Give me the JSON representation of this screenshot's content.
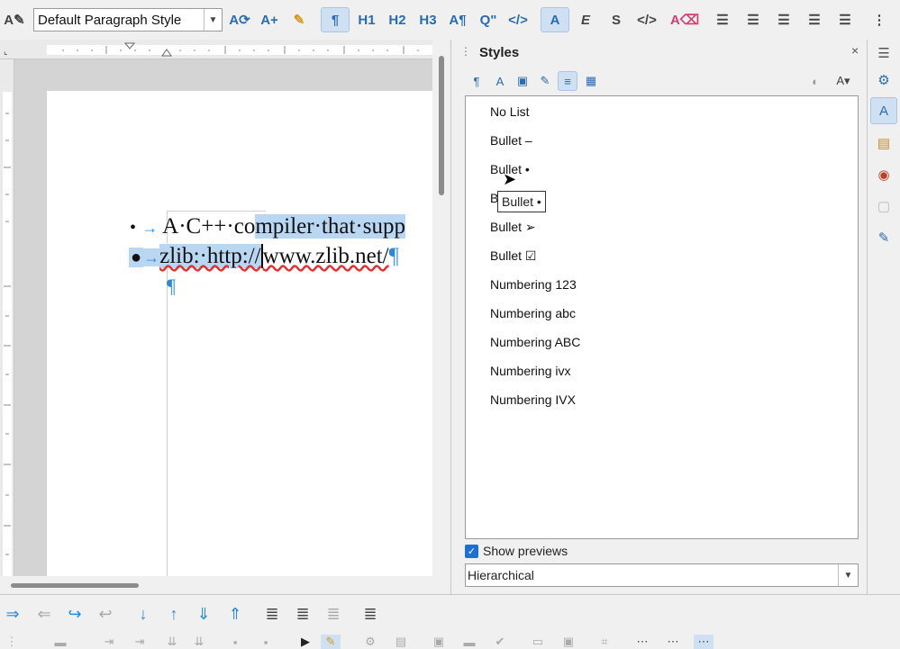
{
  "toolbar": {
    "paragraph_style": "Default Paragraph Style",
    "icons": [
      "styles-icon",
      "update-style-icon",
      "new-style-icon",
      "fill-format-icon",
      "formatting-marks-icon",
      "heading1-icon",
      "heading2-icon",
      "heading3-icon",
      "text-body-icon",
      "quotations-icon",
      "source-text-icon",
      "default-character-icon",
      "emphasis-icon",
      "strong-emphasis-icon",
      "source-code-icon",
      "no-character-style-icon",
      "unordered-list-icon",
      "ordered-list-icon",
      "list-icon-3",
      "list-icon-4",
      "list-icon-5"
    ],
    "labels": {
      "h1": "H1",
      "h2": "H2",
      "h3": "H3"
    }
  },
  "document": {
    "line1_bullet": "•",
    "line1_text_a": "A·C++·co",
    "line1_text_b": "mpiler·that·supp",
    "line2_bullet": "●",
    "line2_text_a": "zlib:·http://",
    "line2_text_b": "www.zlib.net/",
    "para_mark": "¶"
  },
  "sidebar": {
    "title": "Styles",
    "close": "×",
    "list_items": [
      "No List",
      "Bullet –",
      "Bullet •",
      "B",
      "Bullet ➢",
      "Bullet ☑",
      "Numbering 123",
      "Numbering abc",
      "Numbering ABC",
      "Numbering ivx",
      "Numbering IVX"
    ],
    "tooltip": "Bullet •",
    "show_previews_label": "Show previews",
    "show_previews_checked": true,
    "filter_value": "Hierarchical"
  },
  "deck": {
    "icons": [
      "properties-icon",
      "styles-icon",
      "gallery-icon",
      "navigator-icon",
      "page-icon",
      "style-inspector-icon"
    ]
  },
  "bottom_toolbar": {
    "icons": [
      "demote-outline-icon",
      "promote-outline-icon",
      "demote-icon",
      "promote-icon",
      "move-down-icon",
      "move-up-icon",
      "move-down-subpoints-icon",
      "move-up-subpoints-icon",
      "insert-unnumbered-entry-icon",
      "restart-numbering-icon",
      "add-to-list-icon",
      "bullets-numbering-dialog-icon"
    ]
  },
  "colors": {
    "accent": "#2a8ad8",
    "selection": "#b9d6f2",
    "checkbox": "#1d6fd1"
  }
}
